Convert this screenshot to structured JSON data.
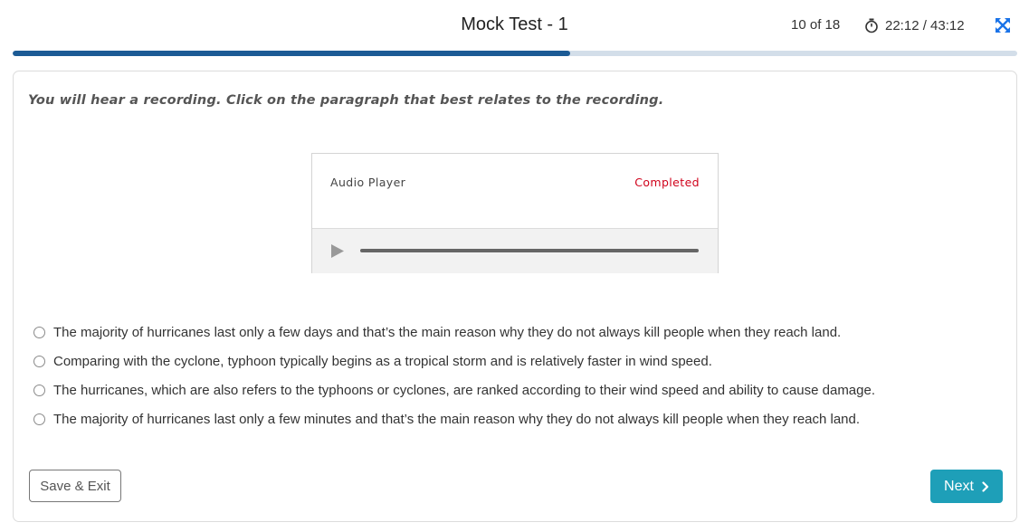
{
  "header": {
    "title": "Mock Test - 1",
    "counter": "10 of 18",
    "timer": "22:12 / 43:12",
    "timer_icon": "stopwatch-icon",
    "expand_icon": "expand-icon",
    "progress": 0.555
  },
  "question": {
    "instruction": "You will hear a recording. Click on the paragraph that best relates to the recording."
  },
  "audio": {
    "label": "Audio Player",
    "status": "Completed",
    "status_color": "#d0021b",
    "play_icon": "play-icon",
    "played_fraction": 1.0
  },
  "options": [
    {
      "text": "The majority of hurricanes last only a few days and that’s the main reason why they do not always kill people when they reach land."
    },
    {
      "text": "Comparing with the cyclone, typhoon typically begins as a tropical storm and is relatively faster in wind speed."
    },
    {
      "text": "The hurricanes, which are also refers to the typhoons or cyclones, are ranked according to their wind speed and ability to cause damage."
    },
    {
      "text": "The majority of hurricanes last only a few minutes and that’s the main reason why they do not always kill people when they reach land."
    }
  ],
  "footer": {
    "save_exit_label": "Save & Exit",
    "next_label": "Next",
    "next_icon": "chevron-right-icon",
    "accent_color": "#1e9fb8",
    "progress_color": "#1c5b95"
  }
}
